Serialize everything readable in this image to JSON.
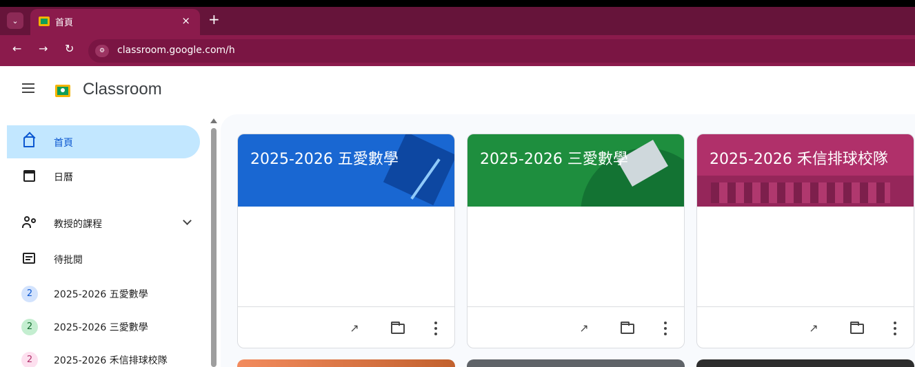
{
  "browser": {
    "tab_title": "首頁",
    "tab_close": "×",
    "new_tab": "+",
    "tab_menu": "⌄",
    "url": "classroom.google.com/h"
  },
  "app": {
    "title": "Classroom"
  },
  "sidebar": {
    "items": [
      {
        "label": "首頁",
        "icon": "home-icon",
        "active": true
      },
      {
        "label": "日曆",
        "icon": "calendar-icon"
      },
      {
        "label": "教授的課程",
        "icon": "people-icon",
        "expandable": true
      },
      {
        "label": "待批閱",
        "icon": "review-tray-icon"
      }
    ],
    "classes": [
      {
        "badge": "2",
        "label": "2025-2026 五愛數學",
        "badge_bg": "#d3e3fd",
        "badge_color": "#0b57d0"
      },
      {
        "badge": "2",
        "label": "2025-2026 三愛數學",
        "badge_bg": "#c4eed0",
        "badge_color": "#146c2e"
      },
      {
        "badge": "2",
        "label": "2025-2026 禾信排球校隊",
        "badge_bg": "#fde0ef",
        "badge_color": "#b0306a"
      }
    ]
  },
  "cards": [
    {
      "title": "2025-2026 五愛數學",
      "banner_color": "#1967d2"
    },
    {
      "title": "2025-2026 三愛數學",
      "banner_color": "#1e8e3e"
    },
    {
      "title": "2025-2026 禾信排球校隊",
      "banner_color": "#b0306a"
    }
  ],
  "card_icons": {
    "progress": "trending-up-icon",
    "folder": "folder-icon",
    "more": "more-vert-icon",
    "progress_glyph": "↗"
  },
  "colors": {
    "tabbar": "#66143a",
    "toolbar": "#8b1b4c",
    "active_nav": "#c2e7ff",
    "main_bg": "#f8fafd"
  }
}
